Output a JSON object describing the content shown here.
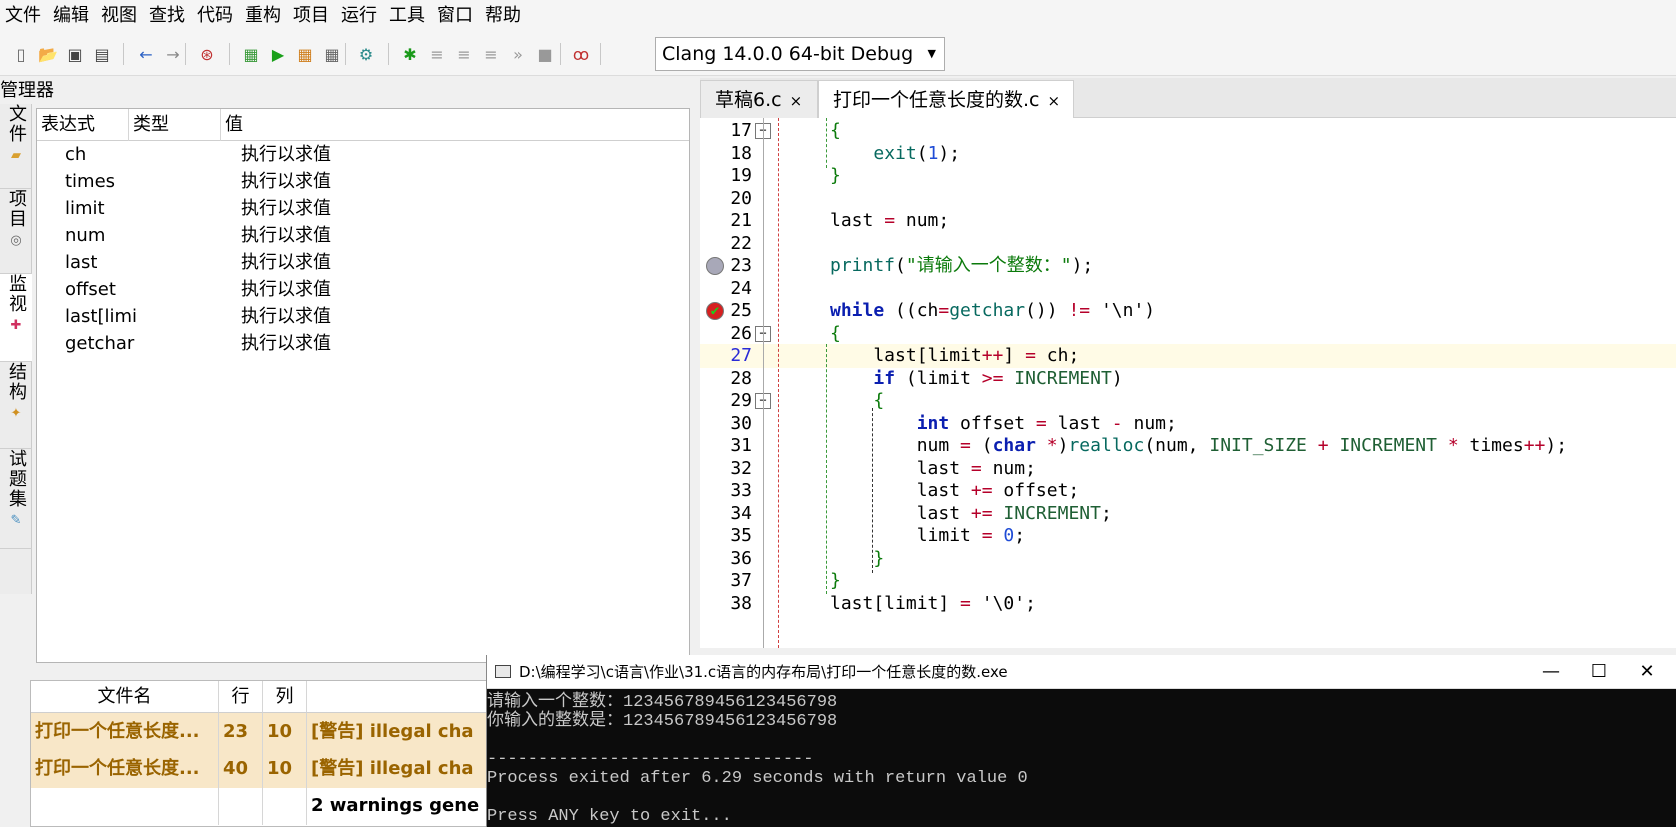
{
  "menu": [
    "文件",
    "编辑",
    "视图",
    "查找",
    "代码",
    "重构",
    "项目",
    "运行",
    "工具",
    "窗口",
    "帮助"
  ],
  "toolbar": {
    "compiler": "Clang 14.0.0 64-bit Debug",
    "icons": [
      "new-file-icon",
      "open-icon",
      "save-icon",
      "save-all-icon",
      "back-icon",
      "forward-icon",
      "goto-icon",
      "compile-icon",
      "run-icon",
      "compile-run-icon",
      "rebuild-icon",
      "check-syntax-icon",
      "debug-icon",
      "indent-icon",
      "unindent-icon",
      "step-icon",
      "next-icon",
      "stop-icon",
      "debug-tool-icon",
      "project-options-icon"
    ]
  },
  "left_panel": {
    "title": "管理器",
    "side_tabs": [
      "文件",
      "项目",
      "监视",
      "结构",
      "试题集"
    ],
    "watch_columns": [
      "表达式",
      "类型",
      "值"
    ],
    "watch_rows": [
      {
        "expr": "ch",
        "type": "",
        "value": "执行以求值"
      },
      {
        "expr": "times",
        "type": "",
        "value": "执行以求值"
      },
      {
        "expr": "limit",
        "type": "",
        "value": "执行以求值"
      },
      {
        "expr": "num",
        "type": "",
        "value": "执行以求值"
      },
      {
        "expr": "last",
        "type": "",
        "value": "执行以求值"
      },
      {
        "expr": "offset",
        "type": "",
        "value": "执行以求值"
      },
      {
        "expr": "last[limi",
        "type": "",
        "value": "执行以求值"
      },
      {
        "expr": "getchar",
        "type": "",
        "value": "执行以求值"
      }
    ]
  },
  "editor": {
    "tabs": [
      {
        "label": "草稿6.c",
        "close": "×",
        "active": false
      },
      {
        "label": "打印一个任意长度的数.c",
        "close": "×",
        "active": true
      }
    ],
    "current_line": 27,
    "breakpoints": [
      23,
      25
    ],
    "lines": [
      {
        "n": "17",
        "code": "{"
      },
      {
        "n": "18",
        "code": "    exit(1);"
      },
      {
        "n": "19",
        "code": "}"
      },
      {
        "n": "20",
        "code": ""
      },
      {
        "n": "21",
        "code": "last = num;"
      },
      {
        "n": "22",
        "code": ""
      },
      {
        "n": "23",
        "code": "printf(\"请输入一个整数：\");"
      },
      {
        "n": "24",
        "code": ""
      },
      {
        "n": "25",
        "code": "while ((ch=getchar()) != '\\n')"
      },
      {
        "n": "26",
        "code": "{"
      },
      {
        "n": "27",
        "code": "    last[limit++] = ch;"
      },
      {
        "n": "28",
        "code": "    if (limit >= INCREMENT)"
      },
      {
        "n": "29",
        "code": "    {"
      },
      {
        "n": "30",
        "code": "        int offset = last - num;"
      },
      {
        "n": "31",
        "code": "        num = (char *)realloc(num, INIT_SIZE + INCREMENT * times++);"
      },
      {
        "n": "32",
        "code": "        last = num;"
      },
      {
        "n": "33",
        "code": "        last += offset;"
      },
      {
        "n": "34",
        "code": "        last += INCREMENT;"
      },
      {
        "n": "35",
        "code": "        limit = 0;"
      },
      {
        "n": "36",
        "code": "    }"
      },
      {
        "n": "37",
        "code": "}"
      },
      {
        "n": "38",
        "code": "last[limit] = '\\0';"
      }
    ]
  },
  "messages": {
    "columns": [
      "文件名",
      "行",
      "列",
      ""
    ],
    "rows": [
      {
        "file": "打印一个任意长度...",
        "line": "23",
        "col": "10",
        "msg": "[警告] illegal cha",
        "kind": "warn"
      },
      {
        "file": "打印一个任意长度...",
        "line": "40",
        "col": "10",
        "msg": "[警告] illegal cha",
        "kind": "warn"
      },
      {
        "file": "",
        "line": "",
        "col": "",
        "msg": "2 warnings gene",
        "kind": "summary"
      }
    ]
  },
  "console": {
    "title": "D:\\编程学习\\c语言\\作业\\31.c语言的内存布局\\打印一个任意长度的数.exe",
    "buttons": {
      "minimize": "—",
      "maximize": "☐",
      "close": "✕"
    },
    "lines": [
      "请输入一个整数：12345678945612345679​8",
      "你输入的整数是：123456789456123456798",
      "",
      "--------------------------------",
      "Process exited after 6.29 seconds with return value 0",
      "",
      "Press ANY key to exit..."
    ]
  }
}
